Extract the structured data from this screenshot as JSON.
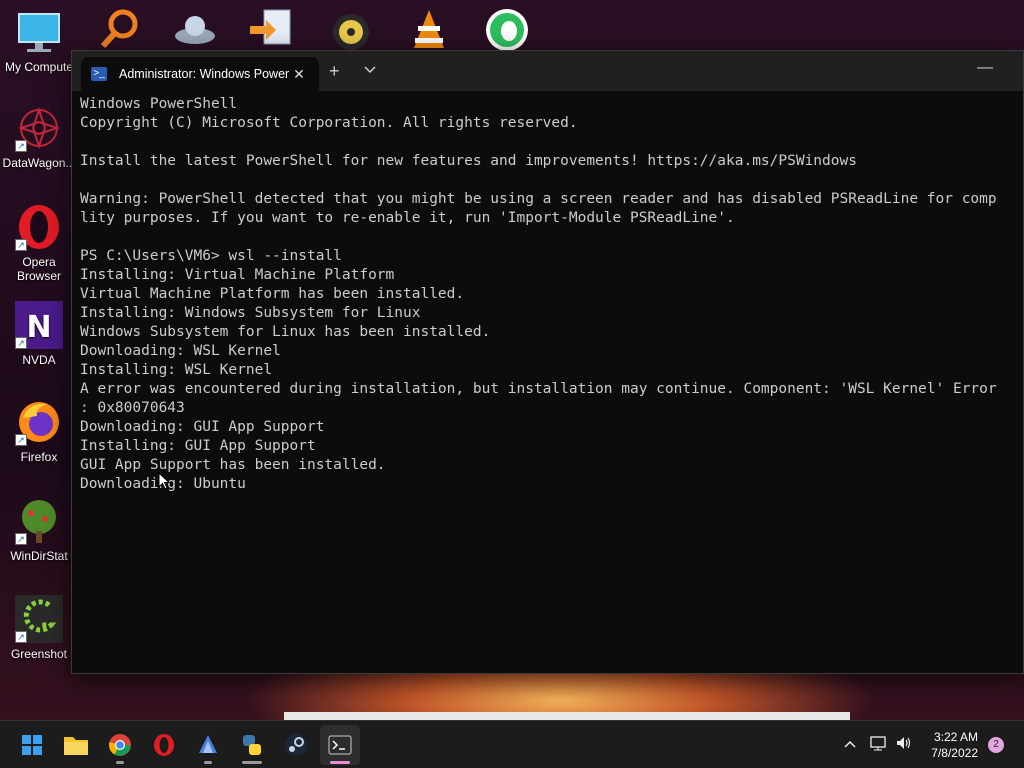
{
  "desktop": {
    "icons": [
      {
        "label": "My Compute"
      },
      {
        "label": "DataWagon..."
      },
      {
        "label": "Opera Browser"
      },
      {
        "label": "NVDA"
      },
      {
        "label": "Firefox"
      },
      {
        "label": "WinDirStat"
      },
      {
        "label": "Greenshot"
      }
    ]
  },
  "window": {
    "tab_title": "Administrator: Windows PowerS",
    "console_lines": [
      "Windows PowerShell",
      "Copyright (C) Microsoft Corporation. All rights reserved.",
      "",
      "Install the latest PowerShell for new features and improvements! https://aka.ms/PSWindows",
      "",
      "Warning: PowerShell detected that you might be using a screen reader and has disabled PSReadLine for comp",
      "lity purposes. If you want to re-enable it, run 'Import-Module PSReadLine'.",
      "",
      "PS C:\\Users\\VM6> wsl --install",
      "Installing: Virtual Machine Platform",
      "Virtual Machine Platform has been installed.",
      "Installing: Windows Subsystem for Linux",
      "Windows Subsystem for Linux has been installed.",
      "Downloading: WSL Kernel",
      "Installing: WSL Kernel",
      "A error was encountered during installation, but installation may continue. Component: 'WSL Kernel' Error",
      ": 0x80070643",
      "Downloading: GUI App Support",
      "Installing: GUI App Support",
      "GUI App Support has been installed.",
      "Downloading: Ubuntu"
    ]
  },
  "taskbar": {
    "time": "3:22 AM",
    "date": "7/8/2022",
    "notification_count": "2"
  },
  "colors": {
    "terminal_bg": "#0c0c0c",
    "terminal_fg": "#cccccc",
    "titlebar": "#202020",
    "taskbar": "#1c1c1c",
    "active_indicator": "#e68ad8"
  }
}
